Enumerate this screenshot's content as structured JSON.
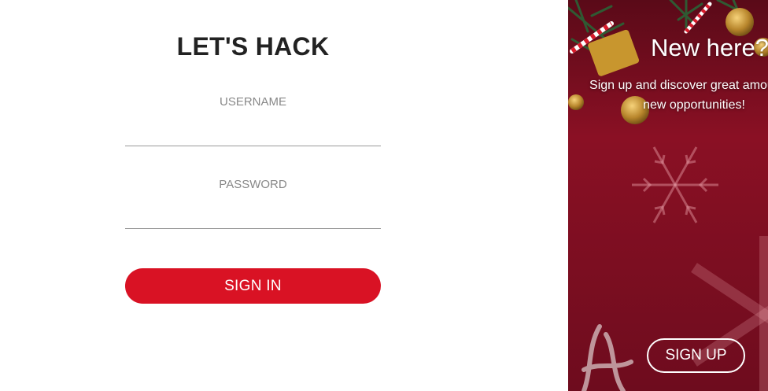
{
  "login_form": {
    "title": "LET'S HACK",
    "username_label": "USERNAME",
    "username_value": "",
    "password_label": "PASSWORD",
    "password_value": "",
    "signin_label": "SIGN IN"
  },
  "promo": {
    "title": "New here?",
    "text": "Sign up and discover great amount of new opportunities!",
    "signup_label": "SIGN UP"
  },
  "colors": {
    "accent": "#d91224",
    "promo_background": "#7a0f22",
    "title_text": "#222222",
    "label_text": "#888888"
  },
  "icons": [
    "christmas-ornament-decoration",
    "snowflake-decoration",
    "candy-cane-decoration"
  ]
}
